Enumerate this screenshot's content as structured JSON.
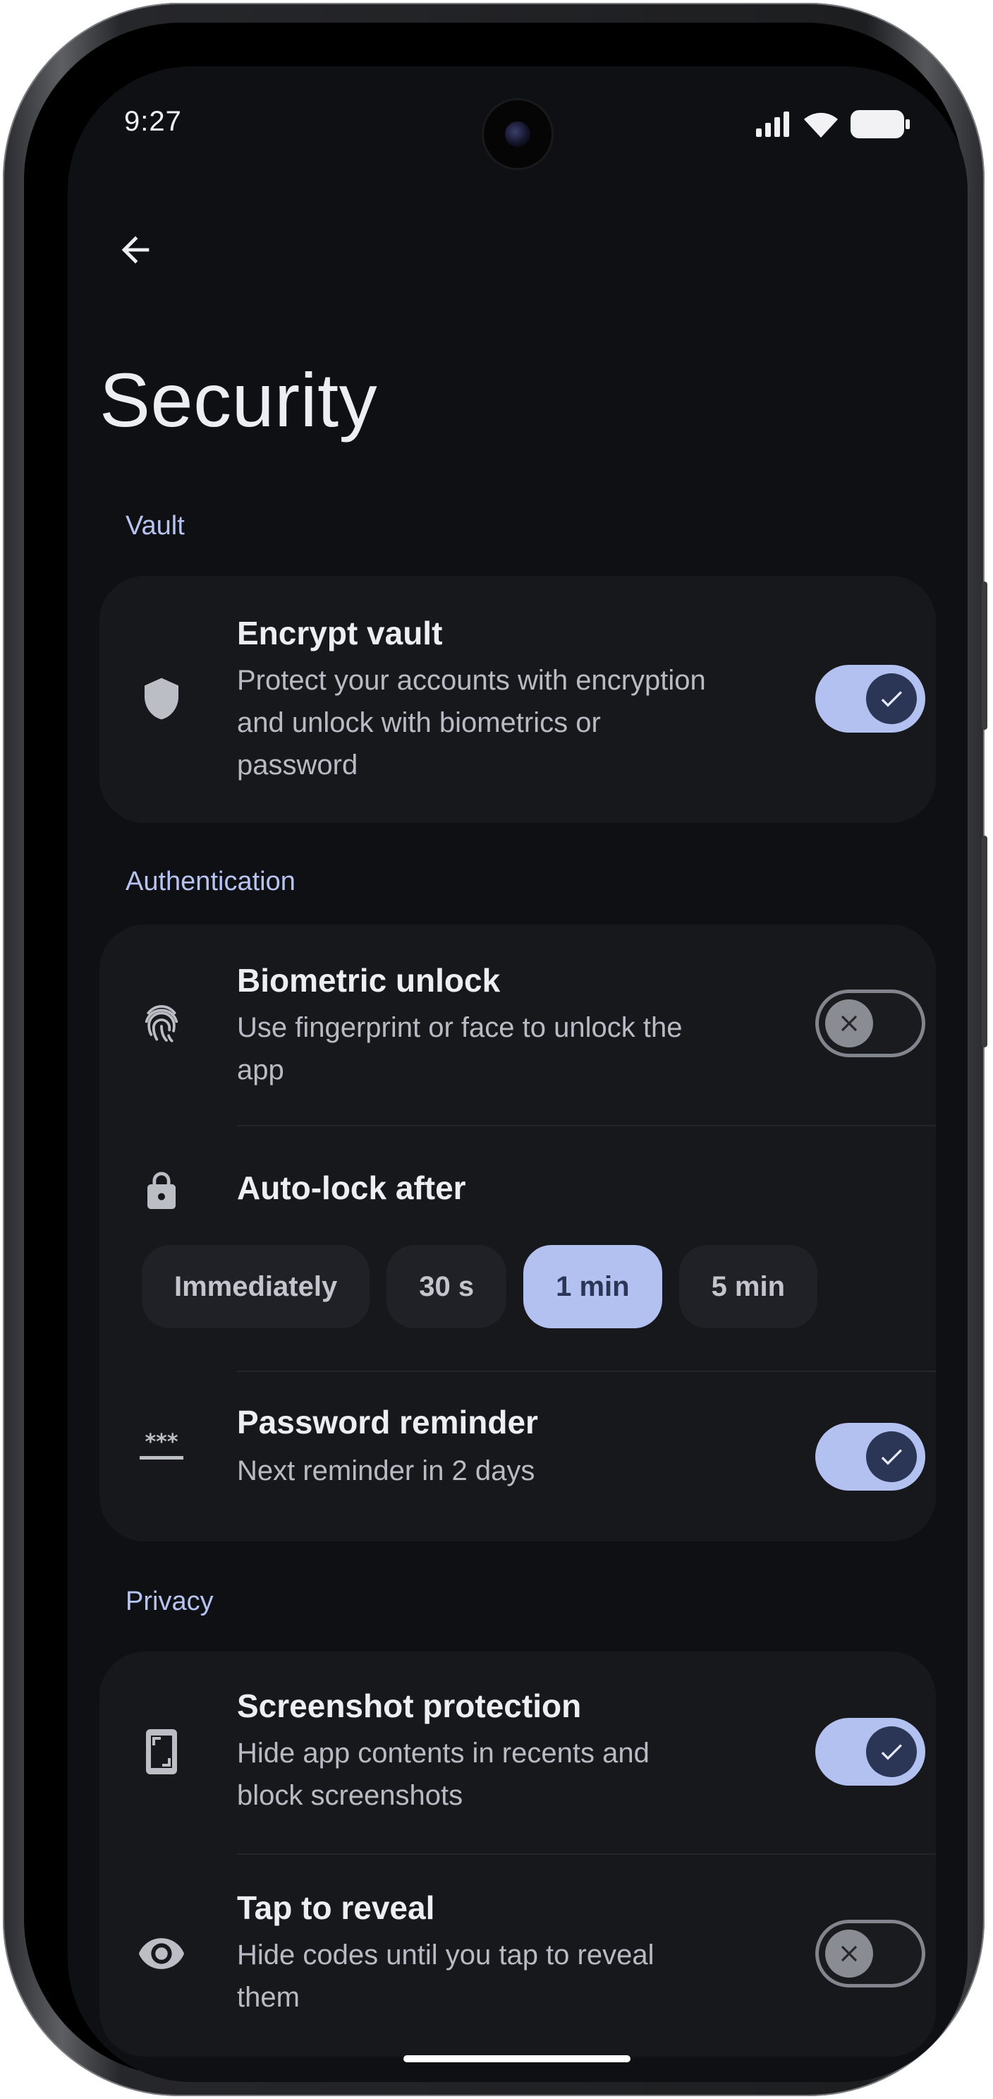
{
  "status_bar": {
    "time": "9:27",
    "icons": [
      "signal-icon",
      "wifi-icon",
      "battery-icon"
    ]
  },
  "header": {
    "back_icon": "arrow-back-icon",
    "title": "Security"
  },
  "sections": {
    "vault": {
      "label": "Vault",
      "encrypt": {
        "icon": "shield-icon",
        "title": "Encrypt vault",
        "subtitle_line1": "Protect your accounts with encryption",
        "subtitle_line2": "and unlock with biometrics or",
        "subtitle_line3": "password",
        "enabled": true
      }
    },
    "authentication": {
      "label": "Authentication",
      "biometric": {
        "icon": "fingerprint-icon",
        "title": "Biometric unlock",
        "subtitle_line1": "Use fingerprint or face to unlock the",
        "subtitle_line2": "app",
        "enabled": false
      },
      "autolock": {
        "icon": "lock-icon",
        "title": "Auto-lock after",
        "options": [
          "Immediately",
          "30 s",
          "1 min",
          "5 min"
        ],
        "selected": "1 min"
      },
      "password_reminder": {
        "icon": "password-icon",
        "title": "Password reminder",
        "subtitle": "Next reminder in 2 days",
        "enabled": true
      }
    },
    "privacy": {
      "label": "Privacy",
      "screenshot": {
        "icon": "screenshot-protection-icon",
        "title": "Screenshot protection",
        "subtitle_line1": "Hide app contents in recents and",
        "subtitle_line2": "block screenshots",
        "enabled": true
      },
      "tap_reveal": {
        "icon": "eye-icon",
        "title": "Tap to reveal",
        "subtitle_line1": "Hide codes until you tap to reveal",
        "subtitle_line2": "them",
        "enabled": false
      }
    }
  },
  "colors": {
    "background": "#0f1013",
    "card": "#17181c",
    "accent": "#b3c1f1",
    "accent_dark": "#2b3556",
    "section_label": "#b7c3f0"
  }
}
